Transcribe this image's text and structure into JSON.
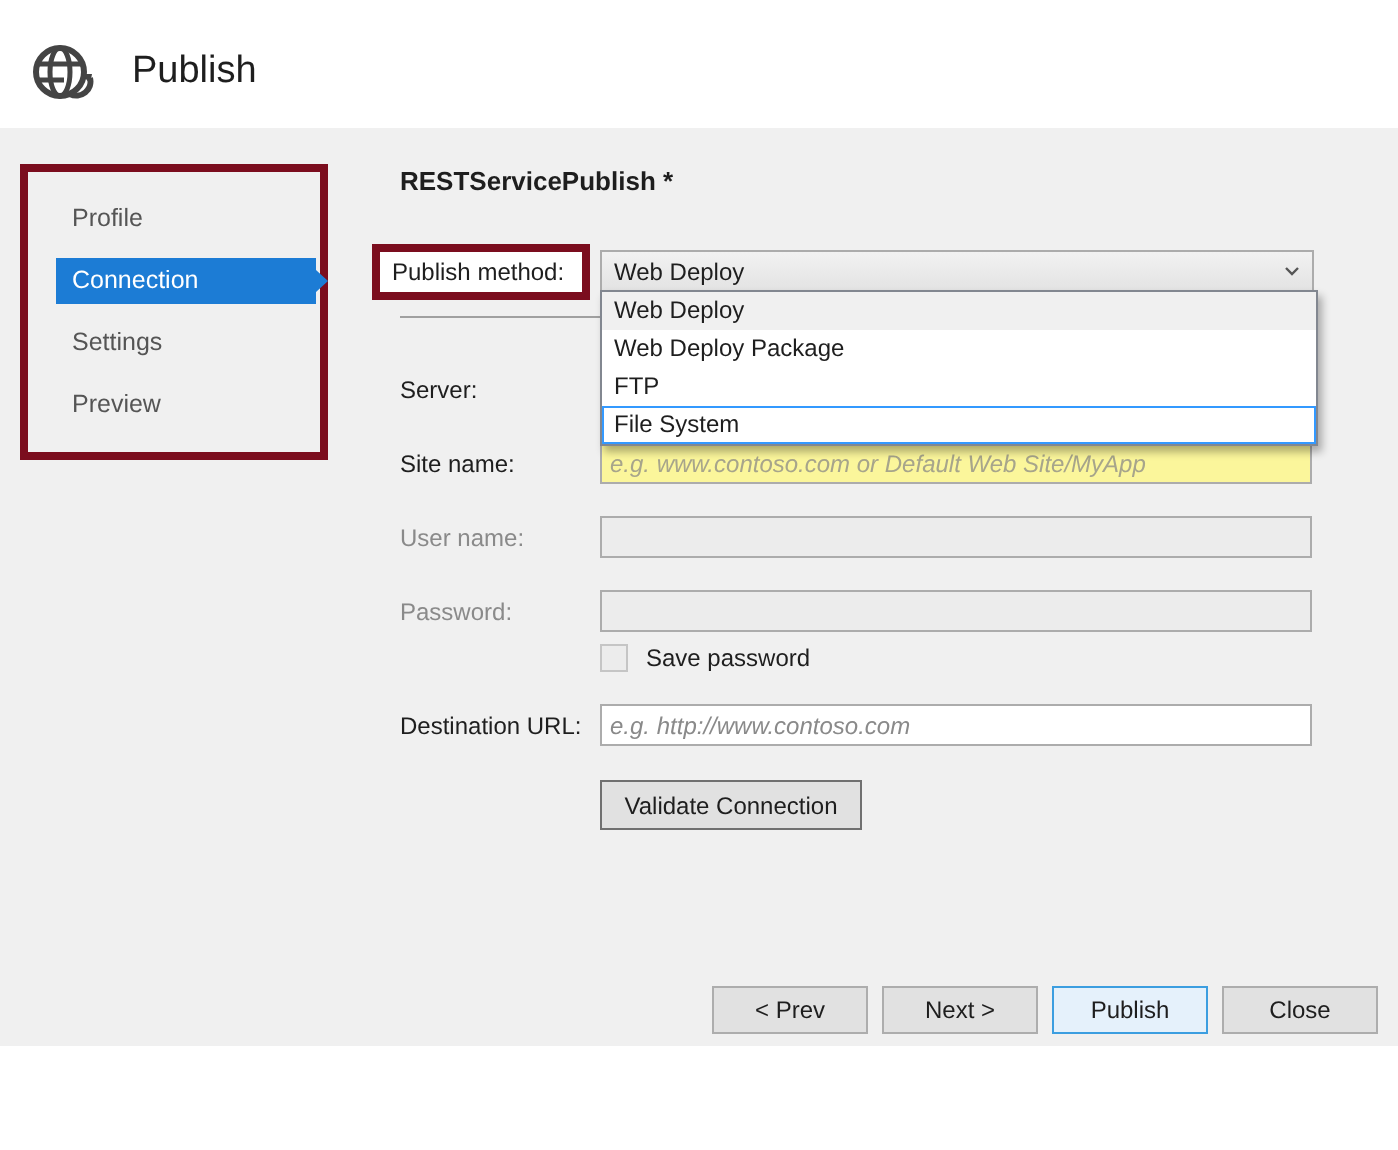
{
  "header": {
    "title": "Publish"
  },
  "sidebar": {
    "items": [
      {
        "label": "Profile",
        "selected": false
      },
      {
        "label": "Connection",
        "selected": true
      },
      {
        "label": "Settings",
        "selected": false
      },
      {
        "label": "Preview",
        "selected": false
      }
    ]
  },
  "profile_title": "RESTServicePublish *",
  "publish_method": {
    "label": "Publish method:",
    "value": "Web Deploy",
    "expanded": true,
    "options": [
      {
        "label": "Web Deploy",
        "selected": true,
        "highlighted": false
      },
      {
        "label": "Web Deploy Package",
        "selected": false,
        "highlighted": false
      },
      {
        "label": "FTP",
        "selected": false,
        "highlighted": false
      },
      {
        "label": "File System",
        "selected": false,
        "highlighted": true
      }
    ]
  },
  "fields": [
    {
      "kind": "label",
      "label": "Server:",
      "disabled": false
    },
    {
      "kind": "input",
      "label": "Site name:",
      "placeholder": "e.g. www.contoso.com or Default Web Site/MyApp",
      "disabled": false,
      "highlighted": true
    },
    {
      "kind": "input",
      "label": "User name:",
      "disabled": true,
      "highlighted": false
    },
    {
      "kind": "input",
      "label": "Password:",
      "disabled": true,
      "highlighted": false
    },
    {
      "kind": "checkbox",
      "label": "Save password",
      "checked": false,
      "disabled": false
    },
    {
      "kind": "input",
      "label": "Destination URL:",
      "placeholder": "e.g. http://www.contoso.com",
      "disabled": false,
      "highlighted": false
    }
  ],
  "validate_button": "Validate Connection",
  "footer_buttons": [
    {
      "label": "< Prev",
      "focused": false
    },
    {
      "label": "Next >",
      "focused": false
    },
    {
      "label": "Publish",
      "focused": true
    },
    {
      "label": "Close",
      "focused": false
    }
  ]
}
